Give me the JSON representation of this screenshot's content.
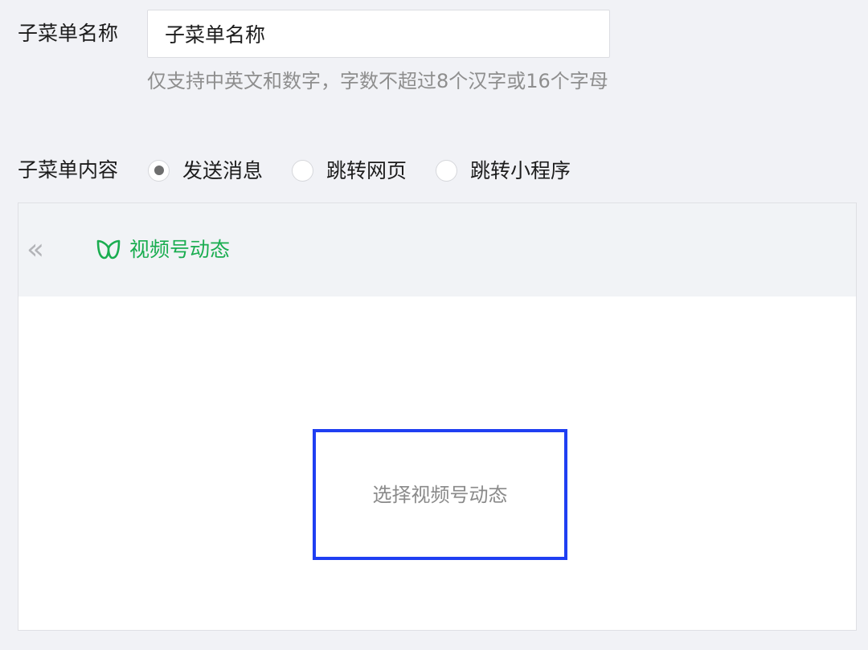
{
  "submenu_name": {
    "label": "子菜单名称",
    "value": "子菜单名称",
    "hint": "仅支持中英文和数字，字数不超过8个汉字或16个字母"
  },
  "submenu_content": {
    "label": "子菜单内容",
    "options": [
      {
        "label": "发送消息",
        "checked": true
      },
      {
        "label": "跳转网页",
        "checked": false
      },
      {
        "label": "跳转小程序",
        "checked": false
      }
    ]
  },
  "panel": {
    "back_icon": "double-chevron-left-icon",
    "tag_icon": "channels-icon",
    "tag_label": "视频号动态",
    "select_label": "选择视频号动态"
  },
  "colors": {
    "accent_green": "#1aad50",
    "highlight_blue": "#1f3ff2"
  }
}
